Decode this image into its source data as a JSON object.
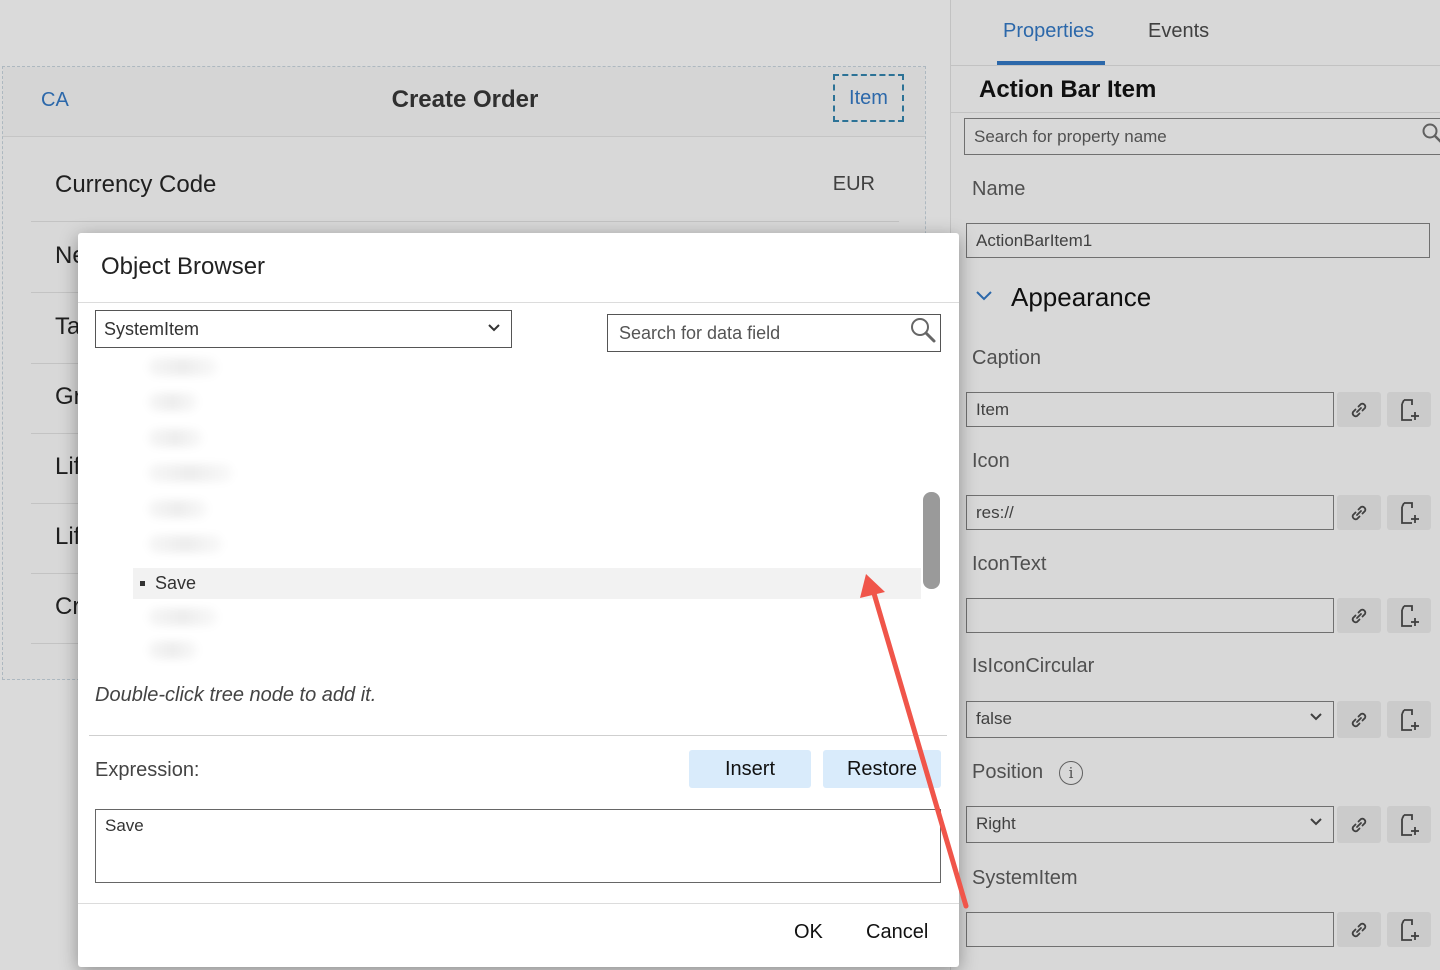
{
  "page": {
    "back_label": "CA",
    "title": "Create Order",
    "action_item_label": "Item",
    "rows": [
      {
        "label": "Currency Code",
        "value": "EUR"
      },
      {
        "label": "Ne",
        "value": ""
      },
      {
        "label": "Ta",
        "value": ""
      },
      {
        "label": "Gr",
        "value": ""
      },
      {
        "label": "Lif",
        "value": ""
      },
      {
        "label": "Lif",
        "value": ""
      },
      {
        "label": "Cr",
        "value": ""
      }
    ]
  },
  "properties_panel": {
    "tabs": [
      {
        "label": "Properties",
        "active": true
      },
      {
        "label": "Events",
        "active": false
      }
    ],
    "title": "Action Bar Item",
    "search_placeholder": "Search for property name",
    "name_label": "Name",
    "name_value": "ActionBarItem1",
    "section_title": "Appearance",
    "fields": [
      {
        "label": "Caption",
        "value": "Item",
        "type": "text"
      },
      {
        "label": "Icon",
        "value": "res://",
        "type": "text"
      },
      {
        "label": "IconText",
        "value": "",
        "type": "text"
      },
      {
        "label": "IsIconCircular",
        "value": "false",
        "type": "select"
      },
      {
        "label": "Position",
        "value": "Right",
        "type": "select"
      },
      {
        "label": "SystemItem",
        "value": "",
        "type": "text"
      }
    ],
    "accent_color": "#2f6fb5"
  },
  "dialog": {
    "title": "Object Browser",
    "type_select_value": "SystemItem",
    "search_placeholder": "Search for data field",
    "tree_selected_item": "Save",
    "hint": "Double-click tree node to add it.",
    "expression_label": "Expression:",
    "insert_label": "Insert",
    "restore_label": "Restore",
    "expression_value": "Save",
    "ok_label": "OK",
    "cancel_label": "Cancel"
  },
  "annotation": {
    "arrow_color": "#f0554a"
  }
}
